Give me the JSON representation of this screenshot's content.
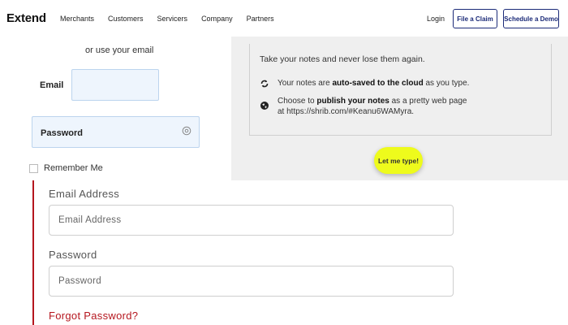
{
  "nav": {
    "logo": "Extend",
    "links": [
      "Merchants",
      "Customers",
      "Servicers",
      "Company",
      "Partners"
    ],
    "login": "Login",
    "file_claim": "File a Claim",
    "schedule_demo": "Schedule a Demo",
    "accent": "#1b2a78"
  },
  "small_form": {
    "or_email": "or use your email",
    "email_label": "Email",
    "password_label": "Password",
    "remember": "Remember Me"
  },
  "notes": {
    "intro": "Take your notes and never lose them again.",
    "feature1": {
      "before": "Your notes are ",
      "bold": "auto-saved to the cloud",
      "after": " as you type.",
      "icon": "sync-icon"
    },
    "feature2": {
      "before": "Choose to ",
      "bold": "publish your notes",
      "after": " as a pretty web page at https://shrib.com/#Keanu6WAMyra.",
      "icon": "globe-icon"
    },
    "cta": "Let me type!",
    "cta_color": "#eefb1c"
  },
  "big_form": {
    "email_label": "Email Address",
    "email_placeholder": "Email Address",
    "password_label": "Password",
    "password_placeholder": "Password",
    "forgot": "Forgot Password?",
    "accent": "#b5161e"
  }
}
